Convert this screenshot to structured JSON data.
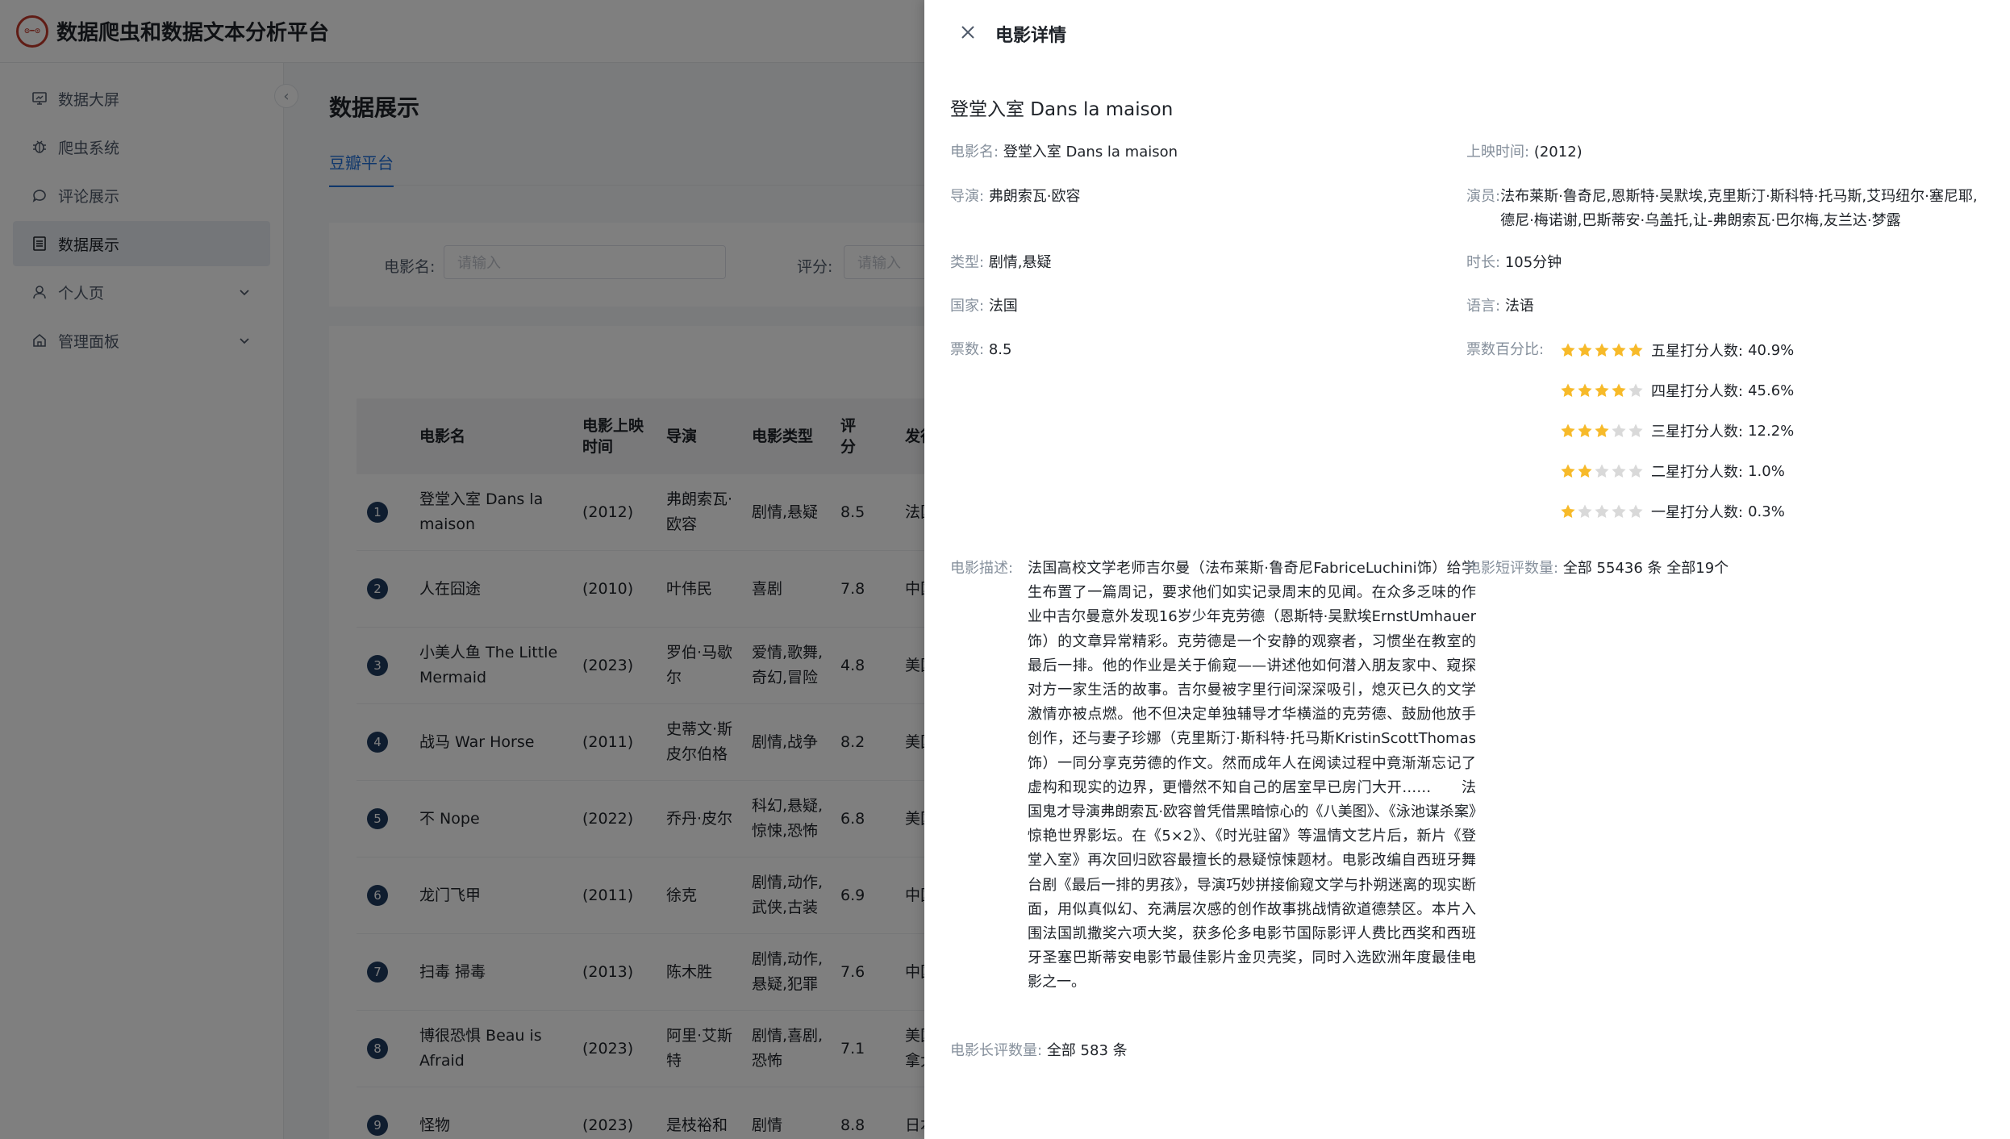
{
  "app": {
    "title": "数据爬虫和数据文本分析平台",
    "logo_text": "⊙━⊙"
  },
  "sidebar": {
    "items": [
      {
        "label": "数据大屏",
        "icon": "monitor-icon"
      },
      {
        "label": "爬虫系统",
        "icon": "bug-icon"
      },
      {
        "label": "评论展示",
        "icon": "comment-icon"
      },
      {
        "label": "数据展示",
        "icon": "list-icon",
        "active": true
      },
      {
        "label": "个人页",
        "icon": "user-icon",
        "expandable": true
      },
      {
        "label": "管理面板",
        "icon": "home-icon",
        "expandable": true
      }
    ],
    "collapse_glyph": "‹"
  },
  "main": {
    "page_title": "数据展示",
    "tab": "豆瓣平台",
    "filters": {
      "movie_label": "电影名:",
      "movie_placeholder": "请输入",
      "score_label": "评分:",
      "score_placeholder": "请输入"
    },
    "table": {
      "headers": [
        "电影名",
        "电影上映时间",
        "导演",
        "电影类型",
        "评分",
        "发行国"
      ],
      "rows": [
        {
          "rank": "1",
          "name": "登堂入室 Dans la maison",
          "date": "(2012)",
          "director": "弗朗索瓦·欧容",
          "genre": "剧情,悬疑",
          "score": "8.5",
          "country": "法国"
        },
        {
          "rank": "2",
          "name": "人在囧途",
          "date": "(2010)",
          "director": "叶伟民",
          "genre": "喜剧",
          "score": "7.8",
          "country": "中国大"
        },
        {
          "rank": "3",
          "name": "小美人鱼 The Little Mermaid",
          "date": "(2023)",
          "director": "罗伯·马歇尔",
          "genre": "爱情,歌舞,奇幻,冒险",
          "score": "4.8",
          "country": "美国"
        },
        {
          "rank": "4",
          "name": "战马 War Horse",
          "date": "(2011)",
          "director": "史蒂文·斯皮尔伯格",
          "genre": "剧情,战争",
          "score": "8.2",
          "country": "美国"
        },
        {
          "rank": "5",
          "name": "不 Nope",
          "date": "(2022)",
          "director": "乔丹·皮尔",
          "genre": "科幻,悬疑,惊悚,恐怖",
          "score": "6.8",
          "country": "美国 /"
        },
        {
          "rank": "6",
          "name": "龙门飞甲",
          "date": "(2011)",
          "director": "徐克",
          "genre": "剧情,动作,武侠,古装",
          "score": "6.9",
          "country": "中国大"
        },
        {
          "rank": "7",
          "name": "扫毒 掃毒",
          "date": "(2013)",
          "director": "陈木胜",
          "genre": "剧情,动作,悬疑,犯罪",
          "score": "7.6",
          "country": "中国大"
        },
        {
          "rank": "8",
          "name": "博很恐惧 Beau is Afraid",
          "date": "(2023)",
          "director": "阿里·艾斯特",
          "genre": "剧情,喜剧,恐怖",
          "score": "7.1",
          "country": "美国 / 加拿大"
        },
        {
          "rank": "9",
          "name": "怪物",
          "date": "(2023)",
          "director": "是枝裕和",
          "genre": "剧情",
          "score": "8.8",
          "country": "日本"
        }
      ]
    }
  },
  "drawer": {
    "title": "电影详情",
    "close_glyph": "✕",
    "movie_title": "登堂入室 Dans la maison",
    "fields": {
      "name_label": "电影名:",
      "name": "登堂入室 Dans la maison",
      "release_label": "上映时间:",
      "release": "(2012)",
      "director_label": "导演:",
      "director": "弗朗索瓦·欧容",
      "actors_label": "演员:",
      "actors": "法布莱斯·鲁奇尼,恩斯特·吴默埃,克里斯汀·斯科特·托马斯,艾玛纽尔·塞尼耶,德尼·梅诺谢,巴斯蒂安·乌盖托,让-弗朗索瓦·巴尔梅,友兰达·梦露",
      "type_label": "类型:",
      "type": "剧情,悬疑",
      "duration_label": "时长:",
      "duration": "105分钟",
      "country_label": "国家:",
      "country": "法国",
      "language_label": "语言:",
      "language": "法语",
      "votes_label": "票数:",
      "votes": "8.5",
      "vote_pct_label": "票数百分比:",
      "desc_label": "电影描述:",
      "desc": "法国高校文学老师吉尔曼（法布莱斯·鲁奇尼FabriceLuchini饰）给学生布置了一篇周记，要求他们如实记录周末的见闻。在众多乏味的作业中吉尔曼意外发现16岁少年克劳德（恩斯特·吴默埃ErnstUmhauer饰）的文章异常精彩。克劳德是一个安静的观察者，习惯坐在教室的最后一排。他的作业是关于偷窥——讲述他如何潜入朋友家中、窥探对方一家生活的故事。吉尔曼被字里行间深深吸引，熄灭已久的文学激情亦被点燃。他不但决定单独辅导才华横溢的克劳德、鼓励他放手创作，还与妻子珍娜（克里斯汀·斯科特·托马斯KristinScottThomas饰）一同分享克劳德的作文。然而成年人在阅读过程中竟渐渐忘记了虚构和现实的边界，更懵然不知自己的居室早已房门大开……　　法国鬼才导演弗朗索瓦·欧容曾凭借黑暗惊心的《八美图》、《泳池谋杀案》惊艳世界影坛。在《5×2》、《时光驻留》等温情文艺片后，新片《登堂入室》再次回归欧容最擅长的悬疑惊悚题材。电影改编自西班牙舞台剧《最后一排的男孩》，导演巧妙拼接偷窥文学与扑朔迷离的现实断面，用似真似幻、充满层次感的创作故事挑战情欲道德禁区。本片入围法国凯撒奖六项大奖，获多伦多电影节国际影评人费比西奖和西班牙圣塞巴斯蒂安电影节最佳影片金贝壳奖，同时入选欧洲年度最佳电影之一。",
      "short_reviews_label": "电影短评数量:",
      "short_reviews": "全部 55436 条 全部19个",
      "long_reviews_label": "电影长评数量:",
      "long_reviews": "全部 583 条"
    },
    "ratings": [
      {
        "stars": 5,
        "label": "五星打分人数:",
        "pct": "40.9%"
      },
      {
        "stars": 4,
        "label": "四星打分人数:",
        "pct": "45.6%"
      },
      {
        "stars": 3,
        "label": "三星打分人数:",
        "pct": "12.2%"
      },
      {
        "stars": 2,
        "label": "二星打分人数:",
        "pct": "1.0%"
      },
      {
        "stars": 1,
        "label": "一星打分人数:",
        "pct": "0.3%"
      }
    ]
  },
  "colors": {
    "accent": "#1e6fd9",
    "star_on": "#f7ba2a",
    "star_off": "#d9d9d9",
    "rank_badge": "#1f3a5f",
    "overlay": "rgba(0,0,0,0.5)"
  }
}
